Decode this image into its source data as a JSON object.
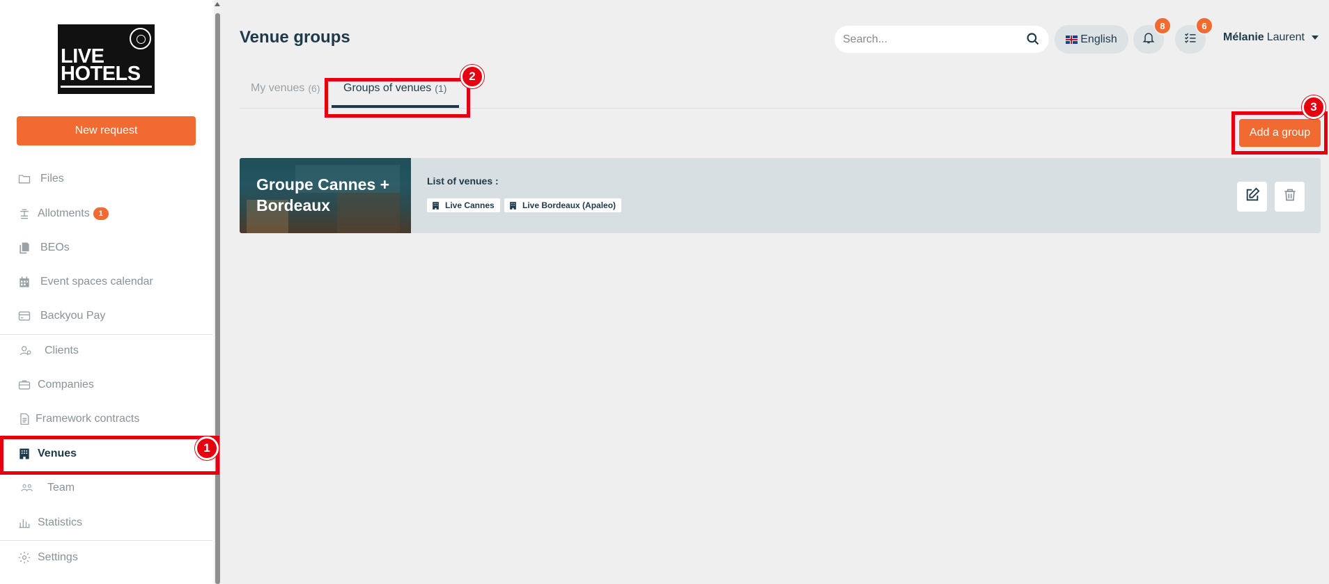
{
  "app": {
    "logo_text_line1": "LIVE",
    "logo_text_line2": "HOTELS",
    "accent_color": "#f06a32",
    "primary_color": "#1e3a4a"
  },
  "sidebar": {
    "new_request_label": "New request",
    "items": [
      {
        "label": "Files",
        "icon": "folder-icon"
      },
      {
        "label": "Allotments",
        "icon": "allotment-icon",
        "badge": "1"
      },
      {
        "label": "BEOs",
        "icon": "documents-icon"
      },
      {
        "label": "Event spaces calendar",
        "icon": "calendar-icon"
      },
      {
        "label": "Backyou Pay",
        "icon": "credit-card-icon"
      },
      {
        "label": "Clients",
        "icon": "clients-icon"
      },
      {
        "label": "Companies",
        "icon": "briefcase-icon"
      },
      {
        "label": "Framework contracts",
        "icon": "contract-icon"
      },
      {
        "label": "Venues",
        "icon": "building-icon",
        "active": true
      },
      {
        "label": "Team",
        "icon": "team-icon"
      },
      {
        "label": "Statistics",
        "icon": "bar-chart-icon"
      },
      {
        "label": "Settings",
        "icon": "gear-icon"
      }
    ]
  },
  "header": {
    "title": "Venue groups",
    "search_placeholder": "Search...",
    "language": "English",
    "notifications_count": "8",
    "tasks_count": "6",
    "user_first": "Mélanie",
    "user_last": "Laurent"
  },
  "tabs": [
    {
      "label": "My venues",
      "count": "(6)"
    },
    {
      "label": "Groups of venues",
      "count": "(1)",
      "active": true
    }
  ],
  "actions": {
    "add_group_label": "Add a group"
  },
  "groups": [
    {
      "title": "Groupe Cannes + Bordeaux",
      "list_label": "List of venues :",
      "venues": [
        "Live Cannes",
        "Live Bordeaux (Apaleo)"
      ]
    }
  ],
  "annotations": [
    "1",
    "2",
    "3"
  ]
}
